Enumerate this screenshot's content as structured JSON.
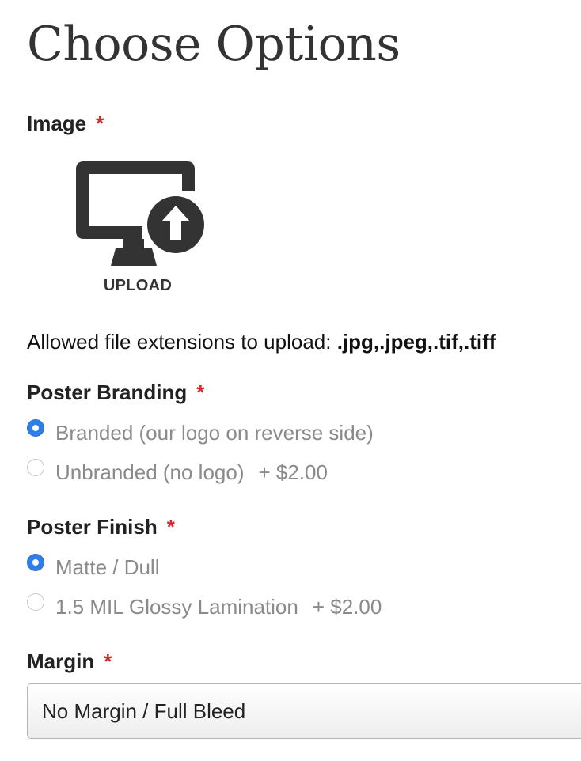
{
  "page": {
    "title": "Choose Options"
  },
  "image_field": {
    "label": "Image",
    "required_mark": "*",
    "upload_label": "UPLOAD",
    "upload_icon": "monitor-upload-icon",
    "extensions_label": "Allowed file extensions to upload: ",
    "extensions_value": ".jpg,.jpeg,.tif,.tiff"
  },
  "poster_branding": {
    "label": "Poster Branding",
    "required_mark": "*",
    "options": [
      {
        "label": "Branded (our logo on reverse side)",
        "price": "",
        "selected": true
      },
      {
        "label": "Unbranded (no logo)",
        "price": "+ $2.00",
        "selected": false
      }
    ]
  },
  "poster_finish": {
    "label": "Poster Finish",
    "required_mark": "*",
    "options": [
      {
        "label": "Matte / Dull",
        "price": "",
        "selected": true
      },
      {
        "label": "1.5 MIL Glossy Lamination",
        "price": "+ $2.00",
        "selected": false
      }
    ]
  },
  "margin": {
    "label": "Margin",
    "required_mark": "*",
    "selected_value": "No Margin / Full Bleed"
  },
  "colors": {
    "required": "#d12b2b",
    "radio_checked": "#2f7ee8",
    "option_text": "#8a8a8a"
  }
}
